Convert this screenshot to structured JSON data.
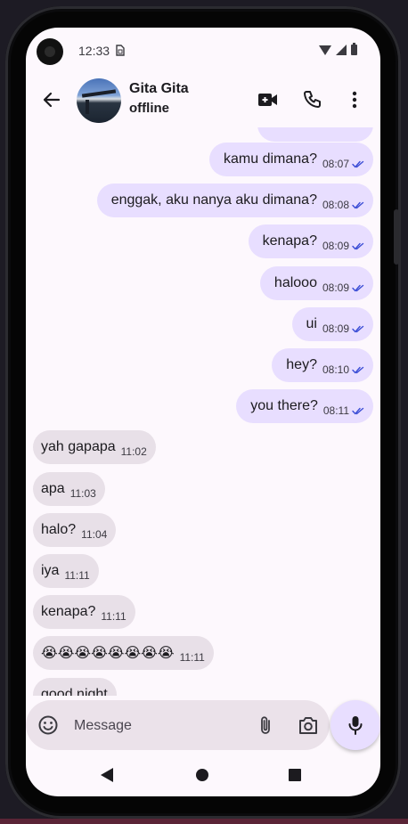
{
  "status_bar": {
    "time": "12:33"
  },
  "header": {
    "contact_name": "Gita Gita",
    "contact_status": "offline"
  },
  "messages": [
    {
      "direction": "out",
      "text": "kamu dimana?",
      "time": "08:07",
      "read": true
    },
    {
      "direction": "out",
      "text": "enggak, aku nanya aku dimana?",
      "time": "08:08",
      "read": true
    },
    {
      "direction": "out",
      "text": "kenapa?",
      "time": "08:09",
      "read": true
    },
    {
      "direction": "out",
      "text": "halooo",
      "time": "08:09",
      "read": true
    },
    {
      "direction": "out",
      "text": "ui",
      "time": "08:09",
      "read": true
    },
    {
      "direction": "out",
      "text": "hey?",
      "time": "08:10",
      "read": true
    },
    {
      "direction": "out",
      "text": "you there?",
      "time": "08:11",
      "read": true
    },
    {
      "direction": "in",
      "text": "yah gapapa",
      "time": "11:02"
    },
    {
      "direction": "in",
      "text": "apa",
      "time": "11:03"
    },
    {
      "direction": "in",
      "text": "halo?",
      "time": "11:04"
    },
    {
      "direction": "in",
      "text": "iya",
      "time": "11:11"
    },
    {
      "direction": "in",
      "text": "kenapa?",
      "time": "11:11"
    },
    {
      "direction": "in",
      "text": "😭😭😭😭😭😭😭😭",
      "time": "11:11"
    },
    {
      "direction": "in",
      "text": "good night",
      "time": ""
    }
  ],
  "composer": {
    "placeholder": "Message"
  },
  "colors": {
    "outgoing_bubble": "#e8deff",
    "incoming_bubble": "#e8e0e8",
    "read_check": "#3d4fd6",
    "background": "#fdf8fd"
  }
}
